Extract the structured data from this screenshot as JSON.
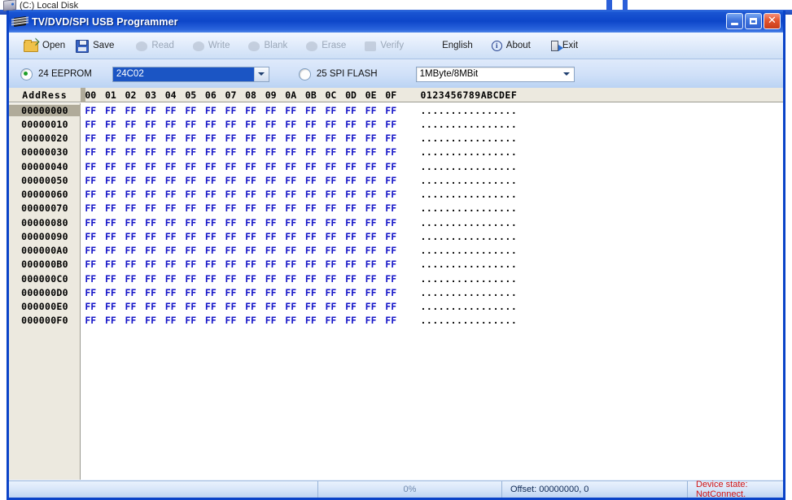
{
  "desktop": {
    "icon_label": "(C:) Local Disk",
    "icon_name": "hard-drive-icon"
  },
  "window": {
    "title": "TV/DVD/SPI USB Programmer",
    "icon_name": "chip-icon",
    "buttons": {
      "minimize": "minimize-button",
      "maximize": "maximize-button",
      "close": "✕"
    }
  },
  "toolbar": {
    "items": [
      {
        "label": "Open",
        "icon": "folder-open-icon",
        "disabled": false
      },
      {
        "label": "Save",
        "icon": "floppy-disk-icon",
        "disabled": false
      },
      {
        "label": "Read",
        "icon": "read-icon",
        "disabled": true
      },
      {
        "label": "Write",
        "icon": "write-icon",
        "disabled": true
      },
      {
        "label": "Blank",
        "icon": "blank-icon",
        "disabled": true
      },
      {
        "label": "Erase",
        "icon": "erase-icon",
        "disabled": true
      },
      {
        "label": "Verify",
        "icon": "verify-icon",
        "disabled": true
      },
      {
        "label": "English",
        "icon": "",
        "disabled": false
      },
      {
        "label": "About",
        "icon": "info-icon",
        "disabled": false
      },
      {
        "label": "Exit",
        "icon": "exit-door-icon",
        "disabled": false
      }
    ]
  },
  "device_bar": {
    "eeprom_radio_label": "24 EEPROM",
    "eeprom_radio_selected": true,
    "eeprom_combo_value": "24C02",
    "spi_radio_label": "25 SPI FLASH",
    "spi_radio_selected": false,
    "size_combo_value": "1MByte/8MBit"
  },
  "hex_view": {
    "address_header": "AddRess",
    "column_headers": [
      "00",
      "01",
      "02",
      "03",
      "04",
      "05",
      "06",
      "07",
      "08",
      "09",
      "0A",
      "0B",
      "0C",
      "0D",
      "0E",
      "0F"
    ],
    "ascii_header": "0123456789ABCDEF",
    "active_row_index": 0,
    "rows": [
      {
        "address": "00000000",
        "bytes": [
          "FF",
          "FF",
          "FF",
          "FF",
          "FF",
          "FF",
          "FF",
          "FF",
          "FF",
          "FF",
          "FF",
          "FF",
          "FF",
          "FF",
          "FF",
          "FF"
        ],
        "ascii": "................"
      },
      {
        "address": "00000010",
        "bytes": [
          "FF",
          "FF",
          "FF",
          "FF",
          "FF",
          "FF",
          "FF",
          "FF",
          "FF",
          "FF",
          "FF",
          "FF",
          "FF",
          "FF",
          "FF",
          "FF"
        ],
        "ascii": "................"
      },
      {
        "address": "00000020",
        "bytes": [
          "FF",
          "FF",
          "FF",
          "FF",
          "FF",
          "FF",
          "FF",
          "FF",
          "FF",
          "FF",
          "FF",
          "FF",
          "FF",
          "FF",
          "FF",
          "FF"
        ],
        "ascii": "................"
      },
      {
        "address": "00000030",
        "bytes": [
          "FF",
          "FF",
          "FF",
          "FF",
          "FF",
          "FF",
          "FF",
          "FF",
          "FF",
          "FF",
          "FF",
          "FF",
          "FF",
          "FF",
          "FF",
          "FF"
        ],
        "ascii": "................"
      },
      {
        "address": "00000040",
        "bytes": [
          "FF",
          "FF",
          "FF",
          "FF",
          "FF",
          "FF",
          "FF",
          "FF",
          "FF",
          "FF",
          "FF",
          "FF",
          "FF",
          "FF",
          "FF",
          "FF"
        ],
        "ascii": "................"
      },
      {
        "address": "00000050",
        "bytes": [
          "FF",
          "FF",
          "FF",
          "FF",
          "FF",
          "FF",
          "FF",
          "FF",
          "FF",
          "FF",
          "FF",
          "FF",
          "FF",
          "FF",
          "FF",
          "FF"
        ],
        "ascii": "................"
      },
      {
        "address": "00000060",
        "bytes": [
          "FF",
          "FF",
          "FF",
          "FF",
          "FF",
          "FF",
          "FF",
          "FF",
          "FF",
          "FF",
          "FF",
          "FF",
          "FF",
          "FF",
          "FF",
          "FF"
        ],
        "ascii": "................"
      },
      {
        "address": "00000070",
        "bytes": [
          "FF",
          "FF",
          "FF",
          "FF",
          "FF",
          "FF",
          "FF",
          "FF",
          "FF",
          "FF",
          "FF",
          "FF",
          "FF",
          "FF",
          "FF",
          "FF"
        ],
        "ascii": "................"
      },
      {
        "address": "00000080",
        "bytes": [
          "FF",
          "FF",
          "FF",
          "FF",
          "FF",
          "FF",
          "FF",
          "FF",
          "FF",
          "FF",
          "FF",
          "FF",
          "FF",
          "FF",
          "FF",
          "FF"
        ],
        "ascii": "................"
      },
      {
        "address": "00000090",
        "bytes": [
          "FF",
          "FF",
          "FF",
          "FF",
          "FF",
          "FF",
          "FF",
          "FF",
          "FF",
          "FF",
          "FF",
          "FF",
          "FF",
          "FF",
          "FF",
          "FF"
        ],
        "ascii": "................"
      },
      {
        "address": "000000A0",
        "bytes": [
          "FF",
          "FF",
          "FF",
          "FF",
          "FF",
          "FF",
          "FF",
          "FF",
          "FF",
          "FF",
          "FF",
          "FF",
          "FF",
          "FF",
          "FF",
          "FF"
        ],
        "ascii": "................"
      },
      {
        "address": "000000B0",
        "bytes": [
          "FF",
          "FF",
          "FF",
          "FF",
          "FF",
          "FF",
          "FF",
          "FF",
          "FF",
          "FF",
          "FF",
          "FF",
          "FF",
          "FF",
          "FF",
          "FF"
        ],
        "ascii": "................"
      },
      {
        "address": "000000C0",
        "bytes": [
          "FF",
          "FF",
          "FF",
          "FF",
          "FF",
          "FF",
          "FF",
          "FF",
          "FF",
          "FF",
          "FF",
          "FF",
          "FF",
          "FF",
          "FF",
          "FF"
        ],
        "ascii": "................"
      },
      {
        "address": "000000D0",
        "bytes": [
          "FF",
          "FF",
          "FF",
          "FF",
          "FF",
          "FF",
          "FF",
          "FF",
          "FF",
          "FF",
          "FF",
          "FF",
          "FF",
          "FF",
          "FF",
          "FF"
        ],
        "ascii": "................"
      },
      {
        "address": "000000E0",
        "bytes": [
          "FF",
          "FF",
          "FF",
          "FF",
          "FF",
          "FF",
          "FF",
          "FF",
          "FF",
          "FF",
          "FF",
          "FF",
          "FF",
          "FF",
          "FF",
          "FF"
        ],
        "ascii": "................"
      },
      {
        "address": "000000F0",
        "bytes": [
          "FF",
          "FF",
          "FF",
          "FF",
          "FF",
          "FF",
          "FF",
          "FF",
          "FF",
          "FF",
          "FF",
          "FF",
          "FF",
          "FF",
          "FF",
          "FF"
        ],
        "ascii": "................"
      }
    ]
  },
  "status_bar": {
    "progress_text": "0%",
    "offset_text": "Offset: 00000000, 0",
    "device_state_text": "Device state: NotConnect."
  },
  "colors": {
    "title_bar_blue": "#0d46c9",
    "hex_value_blue": "#1414c8",
    "error_red": "#d01414",
    "gutter_beige": "#ece9df",
    "selection_blue": "#1b55c4",
    "radio_green": "#1f9e26"
  }
}
